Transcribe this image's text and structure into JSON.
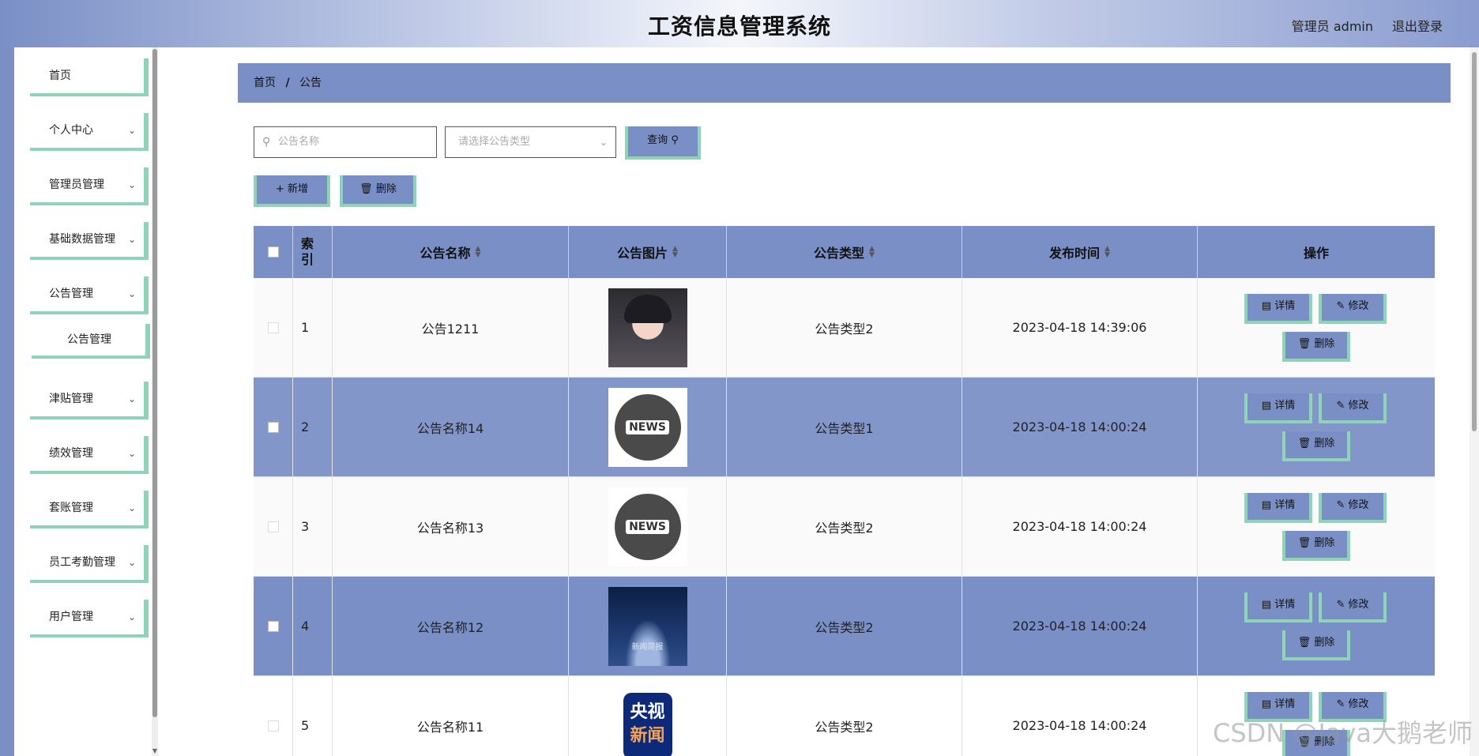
{
  "header": {
    "title": "工资信息管理系统",
    "user": "管理员 admin",
    "logout": "退出登录"
  },
  "sidebar": {
    "items": [
      {
        "label": "首页",
        "has_chevron": false
      },
      {
        "label": "个人中心",
        "has_chevron": true
      },
      {
        "label": "管理员管理",
        "has_chevron": true
      },
      {
        "label": "基础数据管理",
        "has_chevron": true
      },
      {
        "label": "公告管理",
        "has_chevron": true
      },
      {
        "label": "公告管理",
        "sub": true
      },
      {
        "label": "津贴管理",
        "has_chevron": true
      },
      {
        "label": "绩效管理",
        "has_chevron": true
      },
      {
        "label": "套账管理",
        "has_chevron": true
      },
      {
        "label": "员工考勤管理",
        "has_chevron": true
      },
      {
        "label": "用户管理",
        "has_chevron": true
      }
    ]
  },
  "breadcrumb": {
    "home": "首页",
    "separator": "/",
    "current": "公告"
  },
  "search": {
    "name_placeholder": "公告名称",
    "type_placeholder": "请选择公告类型",
    "query_label": "查询"
  },
  "toolbar": {
    "add_label": "新增",
    "delete_label": "删除"
  },
  "table": {
    "headers": {
      "index": "索引",
      "name": "公告名称",
      "image": "公告图片",
      "type": "公告类型",
      "time": "发布时间",
      "ops": "操作"
    },
    "rows": [
      {
        "index": "1",
        "name": "公告1211",
        "image": "portrait",
        "type": "公告类型2",
        "time": "2023-04-18 14:39:06"
      },
      {
        "index": "2",
        "name": "公告名称14",
        "image": "news",
        "type": "公告类型1",
        "time": "2023-04-18 14:00:24"
      },
      {
        "index": "3",
        "name": "公告名称13",
        "image": "news",
        "type": "公告类型2",
        "time": "2023-04-18 14:00:24"
      },
      {
        "index": "4",
        "name": "公告名称12",
        "image": "stage",
        "type": "公告类型2",
        "time": "2023-04-18 14:00:24"
      },
      {
        "index": "5",
        "name": "公告名称11",
        "image": "cctv",
        "type": "公告类型2",
        "time": "2023-04-18 14:00:24"
      }
    ],
    "op_labels": {
      "detail": "详情",
      "edit": "修改",
      "delete": "删除"
    },
    "news_tag": "NEWS",
    "stage_caption": "新闻简报",
    "cctv_top": "央视",
    "cctv_bottom": "新闻"
  },
  "watermark": "CSDN @Java大鹅老师",
  "colors": {
    "primary": "#7a8fc6",
    "accent_border": "#8fd3b8",
    "row_highlight": "#8396c9"
  },
  "icons": {
    "search": "search-icon",
    "chevron": "chevron-down-icon",
    "plus": "plus-icon",
    "trash": "trash-icon",
    "document": "document-icon",
    "pencil": "pencil-icon"
  }
}
